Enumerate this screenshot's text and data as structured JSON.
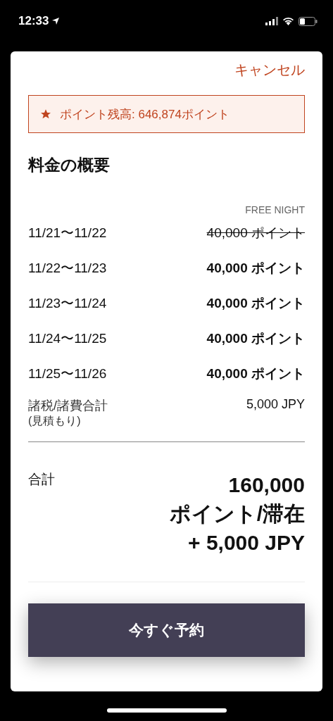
{
  "status_bar": {
    "time": "12:33"
  },
  "cancel": "キャンセル",
  "balance": "ポイント残高: 646,874ポイント",
  "title": "料金の概要",
  "column_label": "FREE NIGHT",
  "nights": [
    {
      "dates": "11/21〜11/22",
      "price": "40,000 ポイント",
      "struck": true
    },
    {
      "dates": "11/22〜11/23",
      "price": "40,000 ポイント",
      "struck": false
    },
    {
      "dates": "11/23〜11/24",
      "price": "40,000 ポイント",
      "struck": false
    },
    {
      "dates": "11/24〜11/25",
      "price": "40,000 ポイント",
      "struck": false
    },
    {
      "dates": "11/25〜11/26",
      "price": "40,000 ポイント",
      "struck": false
    }
  ],
  "taxes": {
    "label": "諸税/諸費合計",
    "note": "(見積もり)",
    "value": "5,000 JPY"
  },
  "total": {
    "label": "合計",
    "lines": [
      "160,000",
      "ポイント/滞在",
      "+ 5,000 JPY"
    ]
  },
  "book_button": "今すぐ予約"
}
